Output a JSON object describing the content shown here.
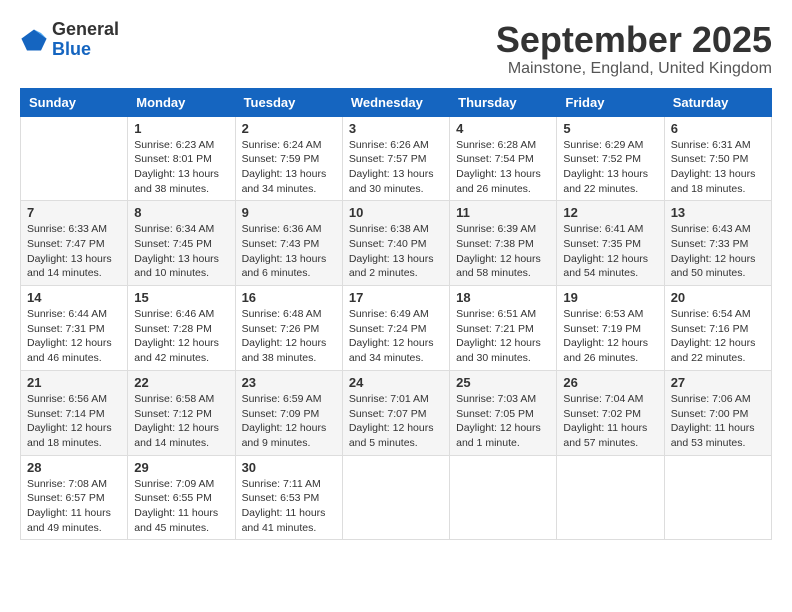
{
  "header": {
    "logo_line1": "General",
    "logo_line2": "Blue",
    "month": "September 2025",
    "location": "Mainstone, England, United Kingdom"
  },
  "weekdays": [
    "Sunday",
    "Monday",
    "Tuesday",
    "Wednesday",
    "Thursday",
    "Friday",
    "Saturday"
  ],
  "weeks": [
    [
      {
        "day": "",
        "info": ""
      },
      {
        "day": "1",
        "info": "Sunrise: 6:23 AM\nSunset: 8:01 PM\nDaylight: 13 hours\nand 38 minutes."
      },
      {
        "day": "2",
        "info": "Sunrise: 6:24 AM\nSunset: 7:59 PM\nDaylight: 13 hours\nand 34 minutes."
      },
      {
        "day": "3",
        "info": "Sunrise: 6:26 AM\nSunset: 7:57 PM\nDaylight: 13 hours\nand 30 minutes."
      },
      {
        "day": "4",
        "info": "Sunrise: 6:28 AM\nSunset: 7:54 PM\nDaylight: 13 hours\nand 26 minutes."
      },
      {
        "day": "5",
        "info": "Sunrise: 6:29 AM\nSunset: 7:52 PM\nDaylight: 13 hours\nand 22 minutes."
      },
      {
        "day": "6",
        "info": "Sunrise: 6:31 AM\nSunset: 7:50 PM\nDaylight: 13 hours\nand 18 minutes."
      }
    ],
    [
      {
        "day": "7",
        "info": "Sunrise: 6:33 AM\nSunset: 7:47 PM\nDaylight: 13 hours\nand 14 minutes."
      },
      {
        "day": "8",
        "info": "Sunrise: 6:34 AM\nSunset: 7:45 PM\nDaylight: 13 hours\nand 10 minutes."
      },
      {
        "day": "9",
        "info": "Sunrise: 6:36 AM\nSunset: 7:43 PM\nDaylight: 13 hours\nand 6 minutes."
      },
      {
        "day": "10",
        "info": "Sunrise: 6:38 AM\nSunset: 7:40 PM\nDaylight: 13 hours\nand 2 minutes."
      },
      {
        "day": "11",
        "info": "Sunrise: 6:39 AM\nSunset: 7:38 PM\nDaylight: 12 hours\nand 58 minutes."
      },
      {
        "day": "12",
        "info": "Sunrise: 6:41 AM\nSunset: 7:35 PM\nDaylight: 12 hours\nand 54 minutes."
      },
      {
        "day": "13",
        "info": "Sunrise: 6:43 AM\nSunset: 7:33 PM\nDaylight: 12 hours\nand 50 minutes."
      }
    ],
    [
      {
        "day": "14",
        "info": "Sunrise: 6:44 AM\nSunset: 7:31 PM\nDaylight: 12 hours\nand 46 minutes."
      },
      {
        "day": "15",
        "info": "Sunrise: 6:46 AM\nSunset: 7:28 PM\nDaylight: 12 hours\nand 42 minutes."
      },
      {
        "day": "16",
        "info": "Sunrise: 6:48 AM\nSunset: 7:26 PM\nDaylight: 12 hours\nand 38 minutes."
      },
      {
        "day": "17",
        "info": "Sunrise: 6:49 AM\nSunset: 7:24 PM\nDaylight: 12 hours\nand 34 minutes."
      },
      {
        "day": "18",
        "info": "Sunrise: 6:51 AM\nSunset: 7:21 PM\nDaylight: 12 hours\nand 30 minutes."
      },
      {
        "day": "19",
        "info": "Sunrise: 6:53 AM\nSunset: 7:19 PM\nDaylight: 12 hours\nand 26 minutes."
      },
      {
        "day": "20",
        "info": "Sunrise: 6:54 AM\nSunset: 7:16 PM\nDaylight: 12 hours\nand 22 minutes."
      }
    ],
    [
      {
        "day": "21",
        "info": "Sunrise: 6:56 AM\nSunset: 7:14 PM\nDaylight: 12 hours\nand 18 minutes."
      },
      {
        "day": "22",
        "info": "Sunrise: 6:58 AM\nSunset: 7:12 PM\nDaylight: 12 hours\nand 14 minutes."
      },
      {
        "day": "23",
        "info": "Sunrise: 6:59 AM\nSunset: 7:09 PM\nDaylight: 12 hours\nand 9 minutes."
      },
      {
        "day": "24",
        "info": "Sunrise: 7:01 AM\nSunset: 7:07 PM\nDaylight: 12 hours\nand 5 minutes."
      },
      {
        "day": "25",
        "info": "Sunrise: 7:03 AM\nSunset: 7:05 PM\nDaylight: 12 hours\nand 1 minute."
      },
      {
        "day": "26",
        "info": "Sunrise: 7:04 AM\nSunset: 7:02 PM\nDaylight: 11 hours\nand 57 minutes."
      },
      {
        "day": "27",
        "info": "Sunrise: 7:06 AM\nSunset: 7:00 PM\nDaylight: 11 hours\nand 53 minutes."
      }
    ],
    [
      {
        "day": "28",
        "info": "Sunrise: 7:08 AM\nSunset: 6:57 PM\nDaylight: 11 hours\nand 49 minutes."
      },
      {
        "day": "29",
        "info": "Sunrise: 7:09 AM\nSunset: 6:55 PM\nDaylight: 11 hours\nand 45 minutes."
      },
      {
        "day": "30",
        "info": "Sunrise: 7:11 AM\nSunset: 6:53 PM\nDaylight: 11 hours\nand 41 minutes."
      },
      {
        "day": "",
        "info": ""
      },
      {
        "day": "",
        "info": ""
      },
      {
        "day": "",
        "info": ""
      },
      {
        "day": "",
        "info": ""
      }
    ]
  ]
}
